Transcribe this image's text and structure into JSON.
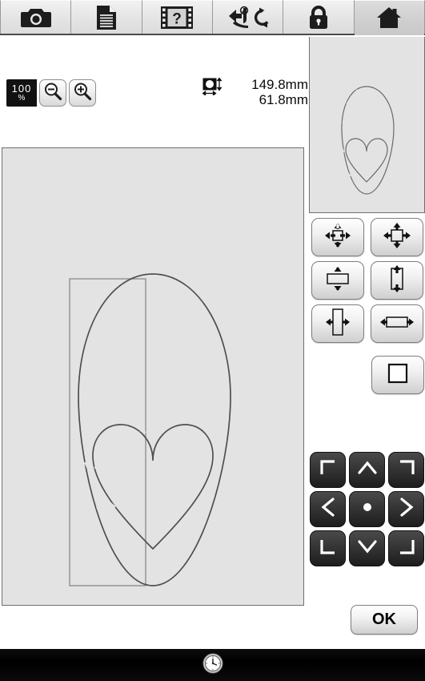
{
  "toolbar": {
    "tabs": [
      {
        "name": "camera",
        "icon": "camera-icon",
        "active": false
      },
      {
        "name": "document",
        "icon": "document-icon",
        "active": false
      },
      {
        "name": "help-video",
        "icon": "film-question-icon",
        "active": false
      },
      {
        "name": "threading",
        "icon": "needle-threader-icon",
        "active": false
      },
      {
        "name": "lock",
        "icon": "lock-icon",
        "active": false
      },
      {
        "name": "home",
        "icon": "home-icon",
        "active": true
      }
    ]
  },
  "zoom": {
    "level": "100",
    "percent_symbol": "%",
    "zoom_out_icon": "magnifier-minus-icon",
    "zoom_in_icon": "magnifier-plus-icon"
  },
  "dimensions": {
    "size_icon": "design-size-icon",
    "height": "149.8",
    "width": "61.8",
    "unit": "mm",
    "height_label": "149.8mm",
    "width_label": "61.8mm"
  },
  "canvas": {
    "name": "design-canvas",
    "design": "heart-in-egg-outline",
    "selection_frame": "rectangular-selection-frame"
  },
  "preview": {
    "name": "design-preview",
    "design": "heart-in-egg-outline"
  },
  "size_buttons": [
    {
      "name": "shrink-all-button",
      "icon": "arrows-inward-icon"
    },
    {
      "name": "grow-all-button",
      "icon": "arrows-outward-icon"
    },
    {
      "name": "shrink-vertical-button",
      "icon": "arrows-vertical-inward-icon"
    },
    {
      "name": "grow-vertical-button",
      "icon": "arrows-vertical-outward-icon"
    },
    {
      "name": "shrink-horizontal-button",
      "icon": "arrows-horizontal-inward-icon"
    },
    {
      "name": "grow-horizontal-button",
      "icon": "arrows-horizontal-outward-icon"
    }
  ],
  "reset_button": {
    "name": "reset-size-button",
    "icon": "square-outline-icon"
  },
  "dpad": [
    {
      "name": "position-top-left-button",
      "icon": "corner-top-left-icon"
    },
    {
      "name": "position-up-button",
      "icon": "chevron-up-icon"
    },
    {
      "name": "position-top-right-button",
      "icon": "corner-top-right-icon"
    },
    {
      "name": "position-left-button",
      "icon": "chevron-left-icon"
    },
    {
      "name": "position-center-button",
      "icon": "dot-icon"
    },
    {
      "name": "position-right-button",
      "icon": "chevron-right-icon"
    },
    {
      "name": "position-bottom-left-button",
      "icon": "corner-bottom-left-icon"
    },
    {
      "name": "position-down-button",
      "icon": "chevron-down-icon"
    },
    {
      "name": "position-bottom-right-button",
      "icon": "corner-bottom-right-icon"
    }
  ],
  "ok_button": {
    "label": "OK"
  },
  "status_bar": {
    "icon": "clock-icon"
  },
  "colors": {
    "canvas_bg": "#e3e3e3",
    "panel_bg": "#ffffff",
    "tab_bg": "#e4e4e4",
    "tab_active_bg": "#c9c9c9",
    "dpad_bg": "#2b2b2b",
    "readout_bg": "#111111",
    "bottom_bar": "#000000",
    "stitch_line": "#4f4f4f"
  }
}
